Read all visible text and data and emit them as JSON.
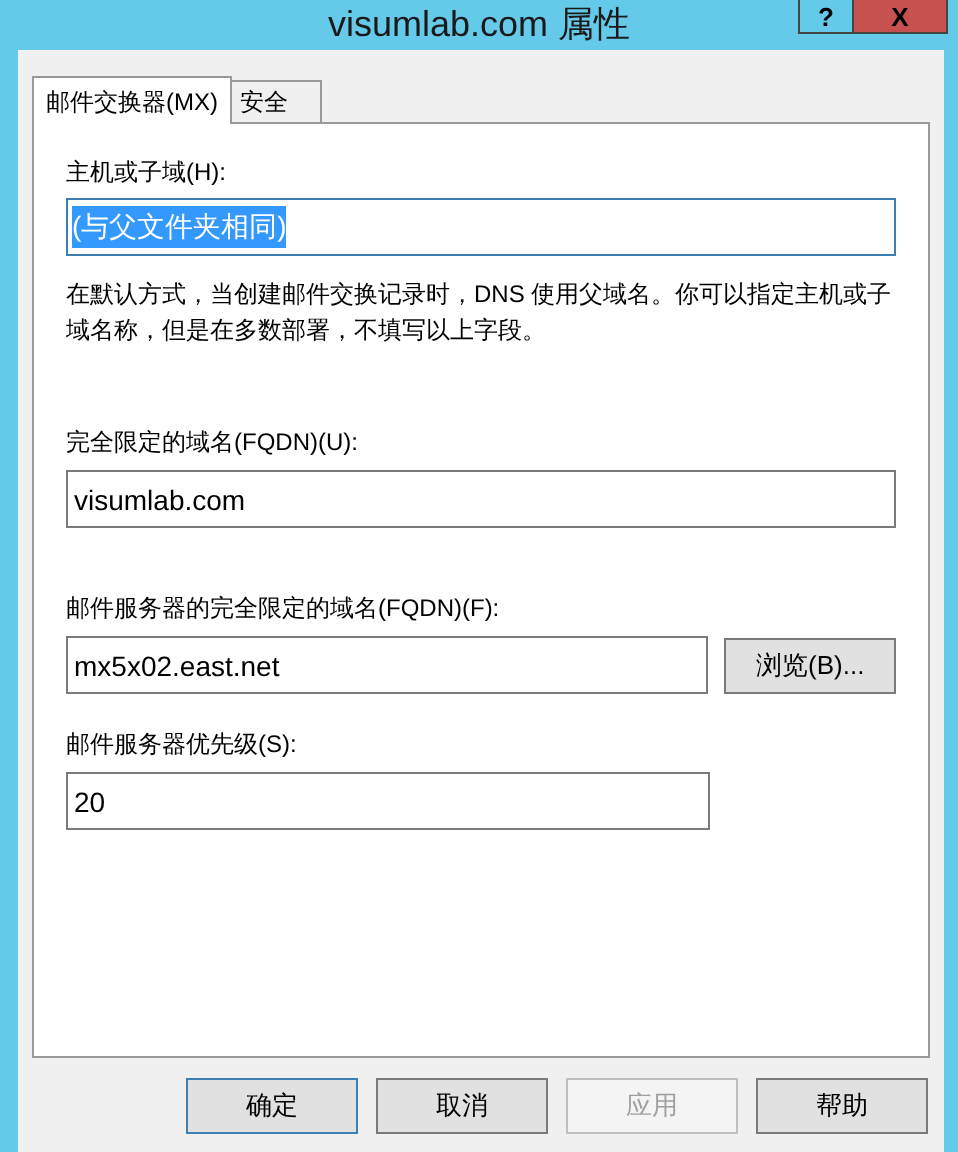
{
  "window": {
    "title": "visumlab.com 属性",
    "help": "?",
    "close": "X"
  },
  "tabs": [
    {
      "label": "邮件交换器(MX)",
      "selected": true
    },
    {
      "label": "安全",
      "selected": false
    }
  ],
  "host": {
    "label": "主机或子域(H):",
    "value": "(与父文件夹相同)",
    "selected": true
  },
  "note": "在默认方式，当创建邮件交换记录时，DNS 使用父域名。你可以指定主机或子域名称，但是在多数部署，不填写以上字段。",
  "fqdn": {
    "label": "完全限定的域名(FQDN)(U):",
    "value": "visumlab.com"
  },
  "server": {
    "label": "邮件服务器的完全限定的域名(FQDN)(F):",
    "value": "mx5x02.east.net",
    "browse": "浏览(B)..."
  },
  "priority": {
    "label": "邮件服务器优先级(S):",
    "value": "20"
  },
  "buttons": [
    {
      "label": "确定",
      "default": true,
      "disabled": false
    },
    {
      "label": "取消",
      "default": false,
      "disabled": false
    },
    {
      "label": "应用",
      "default": false,
      "disabled": true
    },
    {
      "label": "帮助",
      "default": false,
      "disabled": false
    }
  ]
}
